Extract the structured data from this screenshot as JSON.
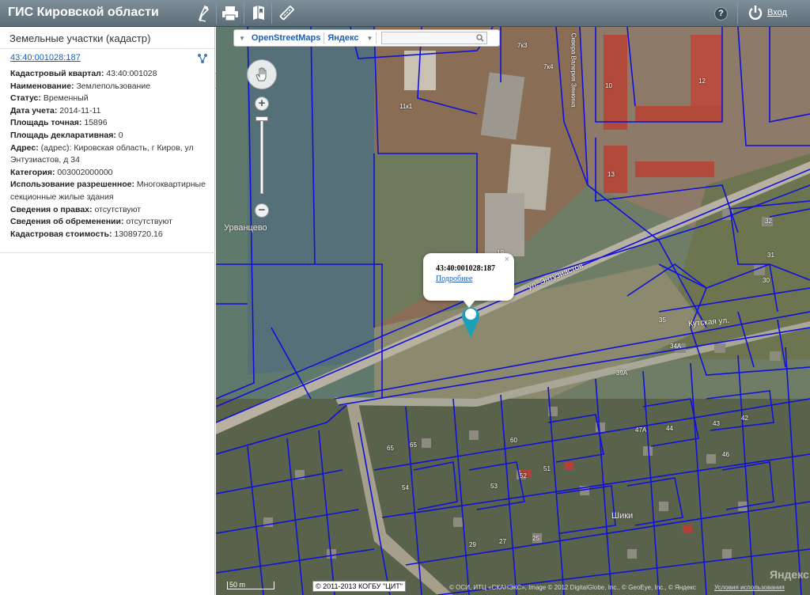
{
  "header": {
    "title": "ГИС Кировской области",
    "logout_label": "Вход",
    "help_label": "?"
  },
  "sidebar": {
    "title": "Земельные участки (кадастр)",
    "cadastral_link": "43:40:001028:187",
    "properties": [
      {
        "label": "Кадастровый квартал:",
        "value": "43:40:001028"
      },
      {
        "label": "Наименование:",
        "value": "Землепользование"
      },
      {
        "label": "Статус:",
        "value": "Временный"
      },
      {
        "label": "Дата учета:",
        "value": "2014-11-11"
      },
      {
        "label": "Площадь точная:",
        "value": "15896"
      },
      {
        "label": "Площадь декларативная:",
        "value": "0"
      },
      {
        "label": "Адрес:",
        "value": "(адрес): Кировская область, г Киров, ул Энтузиастов, д 34"
      },
      {
        "label": "Категория:",
        "value": "003002000000"
      },
      {
        "label": "Использование разрешенное:",
        "value": "Многоквартирные секционные жилые здания"
      },
      {
        "label": "Сведения о правах:",
        "value": "отсутствуют"
      },
      {
        "label": "Сведения об обременении:",
        "value": "отсутствуют"
      },
      {
        "label": "Кадастровая стоимость:",
        "value": "13089720.16"
      }
    ]
  },
  "map": {
    "layers": [
      "OpenStreetMaps",
      "Яндекс"
    ],
    "search_placeholder": "",
    "places": {
      "urvantsevo": "Урванцево",
      "shiki": "Шики",
      "street_entuziastov": "ул. Энтузиастов",
      "street_kutskaya": "Кутская ул.",
      "street_zyabkina": "Сквера Валерия Зянкина"
    },
    "house_numbers": [
      "7к3",
      "7к4",
      "11к1",
      "10",
      "13",
      "12",
      "19",
      "32",
      "31",
      "30",
      "35",
      "34А",
      "39А",
      "47А",
      "44",
      "43",
      "42",
      "46",
      "54",
      "53",
      "52",
      "51",
      "29",
      "27",
      "25",
      "65",
      "60",
      "65"
    ],
    "popup": {
      "title": "43:40:001028:187",
      "link": "Подробнее",
      "close": "×"
    },
    "scale": "50 m",
    "copyright": "© 2011-2013 КОГБУ \"ЦИТ\"",
    "attribution": "© ОСИ, ИТЦ «СКАНЭКС», Image © 2012 DigitalGlobe, Inc., © GeoEye, Inc., © Яндекс",
    "watermark": "Яндекс",
    "terms": "Условия использования"
  },
  "colors": {
    "topbar": "#6f7f8a",
    "link": "#1a5fb4",
    "parcel_lines": "#1010d8",
    "marker": "#1aa0b8"
  }
}
